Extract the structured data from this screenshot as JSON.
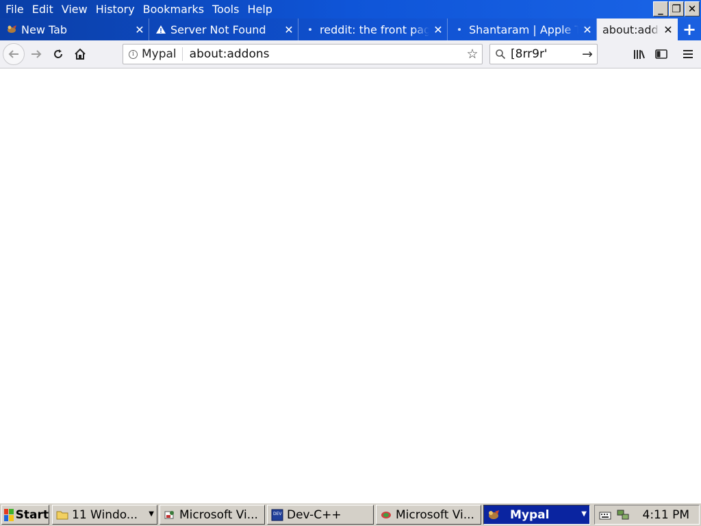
{
  "menu": {
    "items": [
      "File",
      "Edit",
      "View",
      "History",
      "Bookmarks",
      "Tools",
      "Help"
    ]
  },
  "window_controls": {
    "minimize": "_",
    "restore": "❐",
    "close": "✕"
  },
  "tabs": [
    {
      "title": "New Tab",
      "icon": "mypal-icon",
      "active": false
    },
    {
      "title": "Server Not Found",
      "icon": "warning-icon",
      "active": false
    },
    {
      "title": "reddit: the front page",
      "icon": "loading-dot-icon",
      "active": false
    },
    {
      "title": "Shantaram | Apple TV",
      "icon": "loading-dot-icon",
      "active": false
    },
    {
      "title": "about:addons",
      "icon": "",
      "active": true
    }
  ],
  "navbar": {
    "identity_label": "Mypal",
    "url": "about:addons",
    "search_value": "[8rr9r'"
  },
  "taskbar": {
    "start_label": "Start",
    "buttons": [
      {
        "label": "11 Windo...",
        "icon": "folder-icon",
        "grouped": true,
        "active": false
      },
      {
        "label": "Microsoft Vi...",
        "icon": "visual-studio-icon",
        "grouped": false,
        "active": false
      },
      {
        "label": "Dev-C++",
        "icon": "devcpp-icon",
        "grouped": false,
        "active": false
      },
      {
        "label": "Microsoft Vi...",
        "icon": "visual-studio-icon",
        "grouped": false,
        "active": false
      },
      {
        "label": "Mypal",
        "icon": "mypal-icon",
        "grouped": true,
        "active": true
      }
    ],
    "clock": "4:11 PM"
  },
  "colors": {
    "titlebar": "#0f55d8",
    "active_tab": "#f0f0f4",
    "taskbar": "#d4d0c8",
    "active_task": "#0a24a0"
  }
}
